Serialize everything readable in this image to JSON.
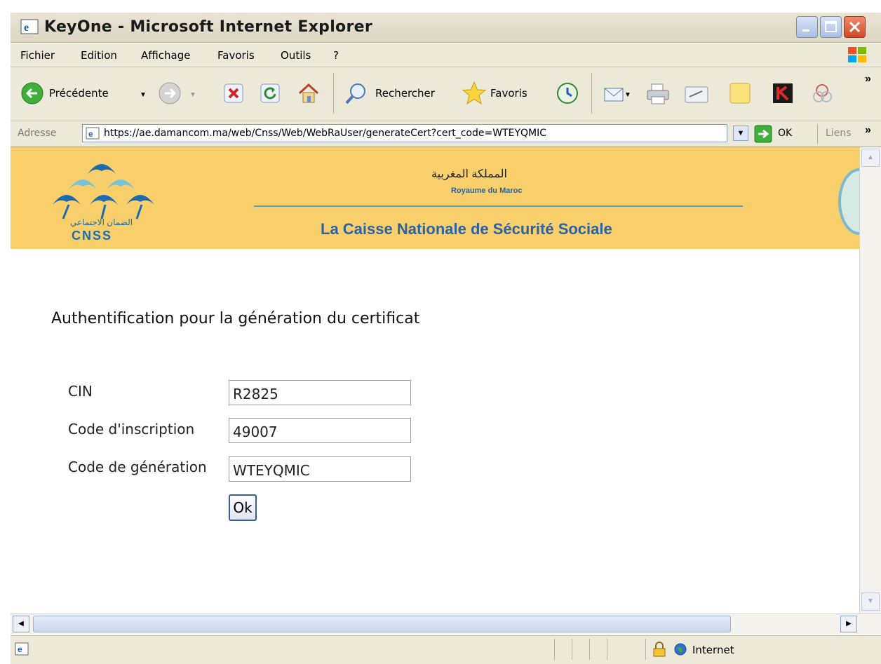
{
  "window": {
    "title": "KeyOne - Microsoft Internet Explorer"
  },
  "menu": [
    "Fichier",
    "Edition",
    "Affichage",
    "Favoris",
    "Outils",
    "?"
  ],
  "toolbar": {
    "back_label": "Précédente",
    "search_label": "Rechercher",
    "favorites_label": "Favoris"
  },
  "address": {
    "label": "Adresse",
    "url": "https://ae.damancom.ma/web/Cnss/Web/WebRaUser/generateCert?cert_code=WTEYQMIC",
    "go_label": "OK",
    "links_label": "Liens"
  },
  "banner": {
    "arabic_kingdom": "المملكة المغربية",
    "kingdom": "Royaume du Maroc",
    "institution": "La Caisse Nationale de Sécurité Sociale",
    "logo_arabic": "الضمان الاجتماعي",
    "logo_text": "CNSS"
  },
  "form": {
    "heading": "Authentification pour la génération du certificat",
    "fields": [
      {
        "label": "CIN",
        "value": "R2825"
      },
      {
        "label": "Code d'inscription",
        "value": "49007"
      },
      {
        "label": "Code de génération",
        "value": "WTEYQMIC"
      }
    ],
    "submit_label": "Ok"
  },
  "status": {
    "zone": "Internet"
  },
  "colors": {
    "banner": "#f9cf6b",
    "banner_text": "#2a62a6",
    "logo_blue": "#1c6ab0"
  }
}
